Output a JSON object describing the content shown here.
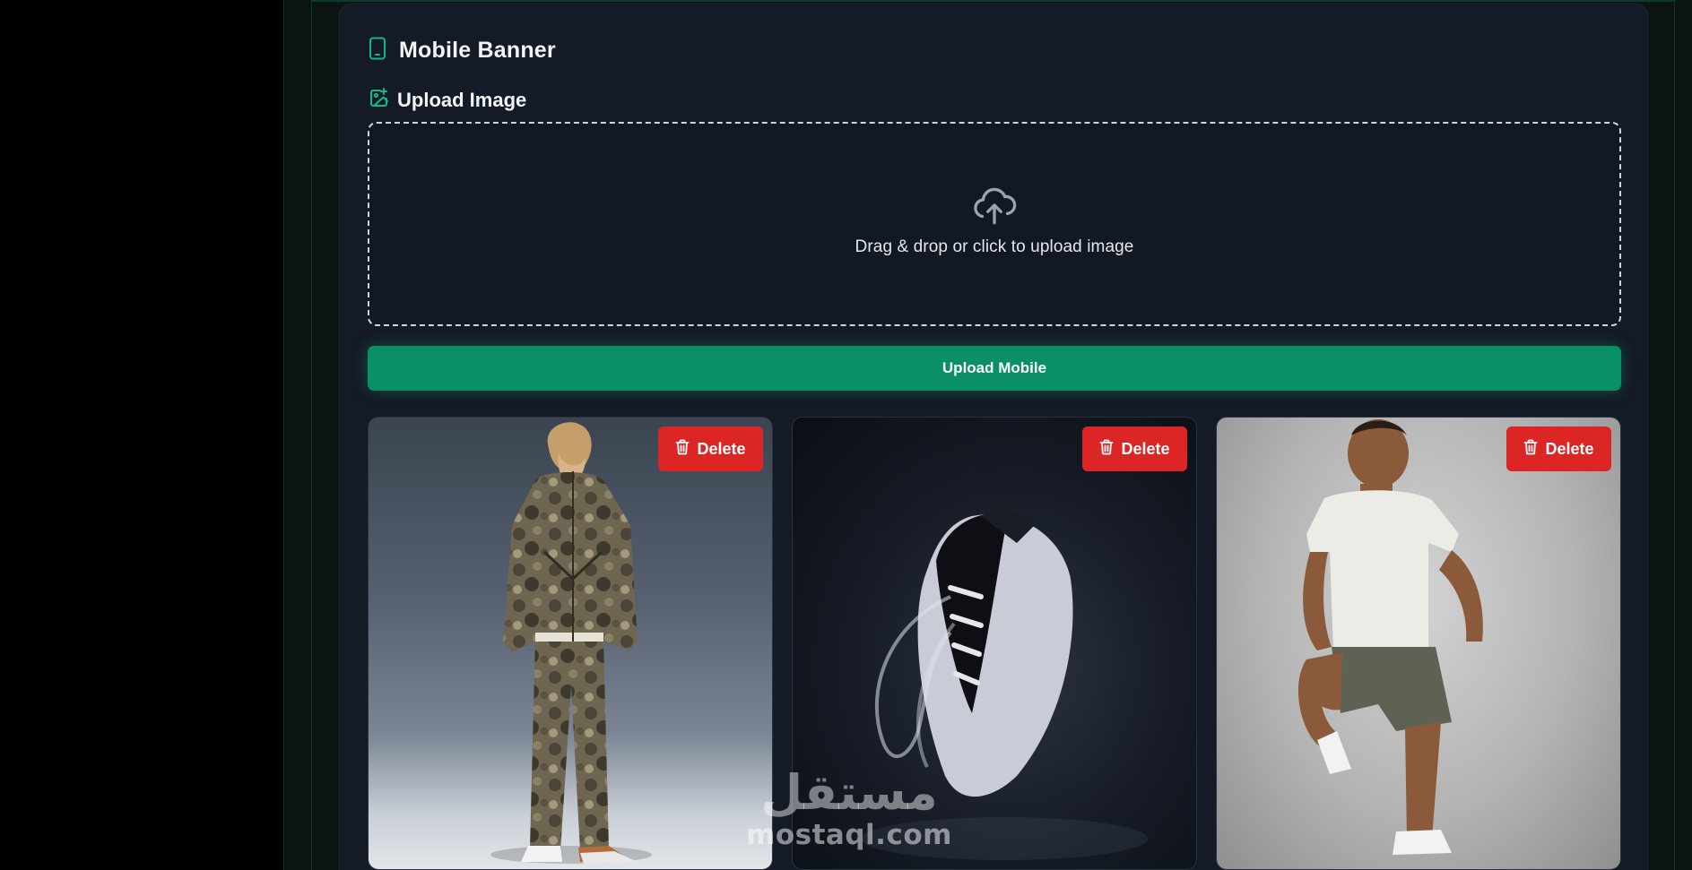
{
  "panel": {
    "title": "Mobile Banner",
    "title_icon": "smartphone-icon",
    "upload_label": "Upload Image",
    "upload_label_icon": "image-plus-icon"
  },
  "dropzone": {
    "icon": "cloud-upload-icon",
    "text": "Drag & drop or click to upload image"
  },
  "upload_button": {
    "label": "Upload Mobile"
  },
  "images": [
    {
      "subject": "model-camo-tracksuit",
      "delete_label": "Delete",
      "delete_icon": "trash-icon"
    },
    {
      "subject": "white-sneaker",
      "delete_label": "Delete",
      "delete_icon": "trash-icon"
    },
    {
      "subject": "athlete-running",
      "delete_label": "Delete",
      "delete_icon": "trash-icon"
    }
  ],
  "watermark": {
    "arabic": "مستقل",
    "latin": "mostaql.com"
  },
  "colors": {
    "accent": "#10b981",
    "primary_button": "#0a8f66",
    "danger": "#dc2626",
    "panel_bg": "#141a26",
    "page_bg": "#000000"
  }
}
